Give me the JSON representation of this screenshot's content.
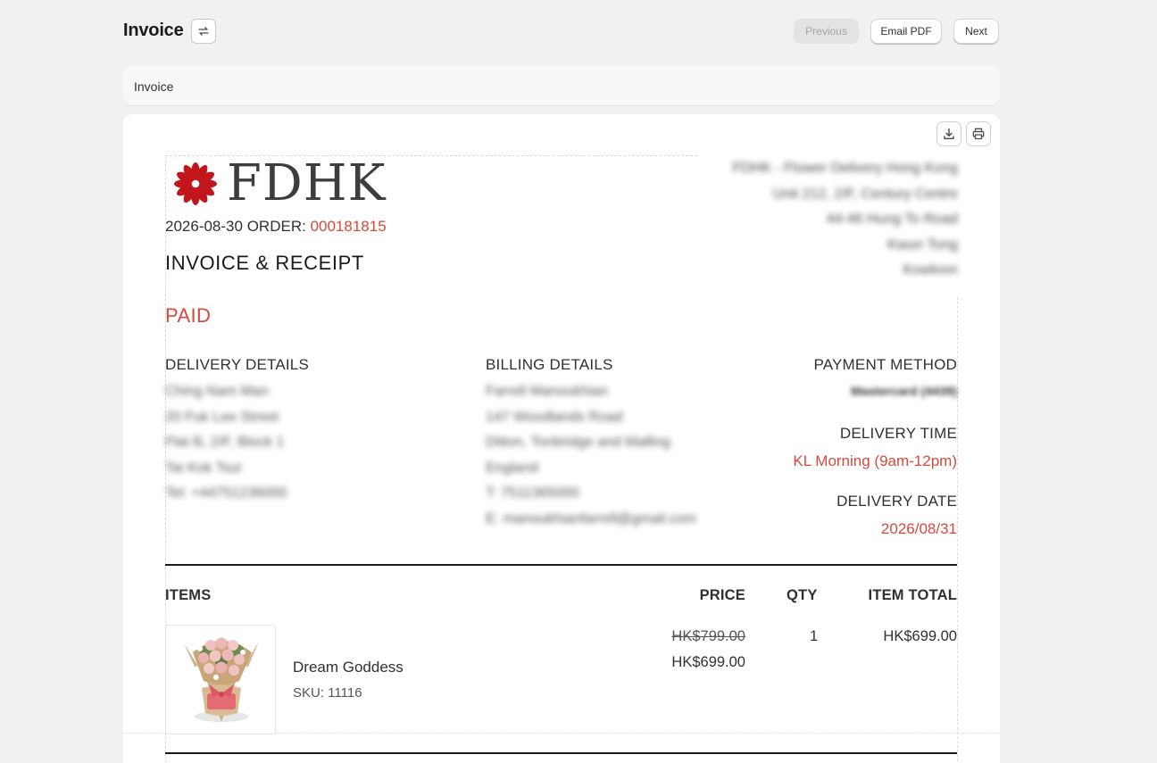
{
  "header": {
    "title": "Invoice",
    "buttons": {
      "previous": "Previous",
      "email_pdf": "Email PDF",
      "next": "Next"
    }
  },
  "section": {
    "label": "Invoice"
  },
  "invoice": {
    "brand": "FDHK",
    "order_date": "2026-08-30",
    "order_prefix": "ORDER:",
    "order_number": "000181815",
    "title": "INVOICE & RECEIPT",
    "status": "PAID",
    "company_address_blurred": [
      "FDHK - Flower Delivery Hong Kong",
      "Unit 212, 2/F, Century Centre",
      "44-46 Hung To Road",
      "Kwun Tong",
      "Kowloon"
    ],
    "delivery": {
      "heading": "DELIVERY DETAILS",
      "lines_blurred": [
        "Ching Nam Man",
        "20 Fuk Lee Street",
        "Flat B, 2/F, Block 1",
        "Tai Kok Tsui",
        "Tel: +44751236000"
      ]
    },
    "billing": {
      "heading": "BILLING DETAILS",
      "lines_blurred": [
        "Farrell Manoukhian",
        "147 Woodlands Road",
        "Ditton, Tonbridge and Malling",
        "England",
        "T: 7511365000",
        "E: manoukhianfarrell@gmail.com"
      ]
    },
    "payment": {
      "heading": "PAYMENT METHOD",
      "value_blurred": "Mastercard (4439)",
      "delivery_time_heading": "DELIVERY TIME",
      "delivery_time": "KL Morning (9am-12pm)",
      "delivery_date_heading": "DELIVERY DATE",
      "delivery_date": "2026/08/31"
    },
    "table": {
      "headers": {
        "items": "ITEMS",
        "price": "PRICE",
        "qty": "QTY",
        "total": "ITEM TOTAL"
      },
      "rows": [
        {
          "name": "Dream Goddess",
          "sku": "SKU: 11116",
          "price_original": "HK$799.00",
          "price": "HK$699.00",
          "qty": "1",
          "total": "HK$699.00"
        }
      ]
    },
    "colors": {
      "accent": "#d8493c",
      "logo_flower": "#c3151c"
    }
  }
}
